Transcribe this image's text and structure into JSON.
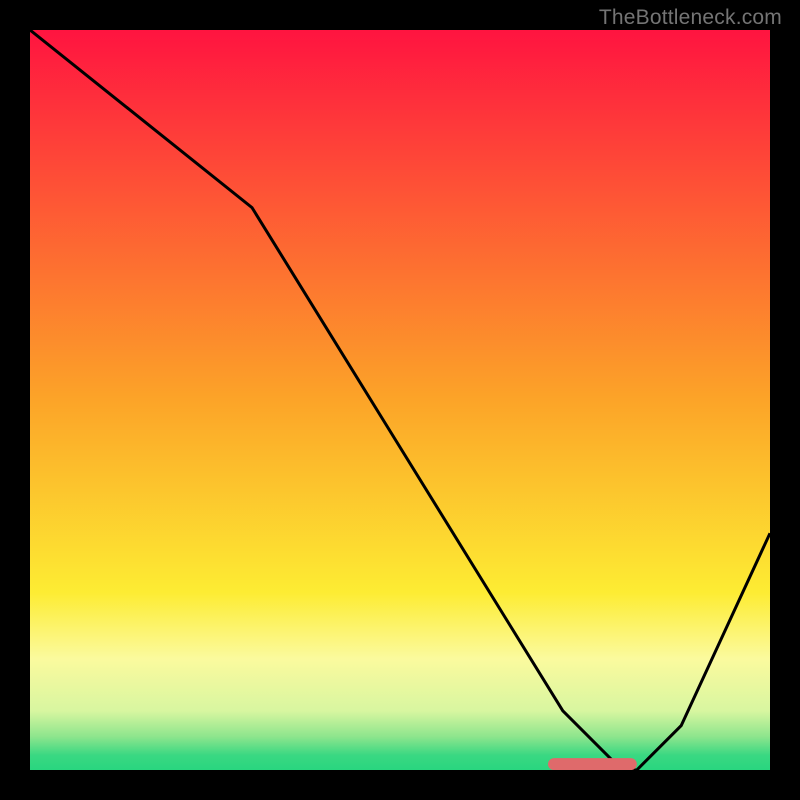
{
  "watermark": "TheBottleneck.com",
  "chart_data": {
    "type": "line",
    "title": "",
    "xlabel": "",
    "ylabel": "",
    "xlim": [
      0,
      100
    ],
    "ylim": [
      0,
      100
    ],
    "x": [
      0,
      30,
      72,
      80,
      82,
      88,
      100
    ],
    "values": [
      100,
      76,
      8,
      0,
      0,
      6,
      32
    ],
    "marker": {
      "x_start": 70,
      "x_end": 82,
      "y": 0.8,
      "color": "#df6a6b"
    },
    "gradient_stops": [
      {
        "offset": 0.0,
        "color": "#ff1440"
      },
      {
        "offset": 0.5,
        "color": "#fca428"
      },
      {
        "offset": 0.76,
        "color": "#fdec33"
      },
      {
        "offset": 0.85,
        "color": "#fbfa9e"
      },
      {
        "offset": 0.92,
        "color": "#d8f6a0"
      },
      {
        "offset": 0.955,
        "color": "#8de58d"
      },
      {
        "offset": 0.98,
        "color": "#3ad882"
      },
      {
        "offset": 1.0,
        "color": "#29d67f"
      }
    ]
  }
}
